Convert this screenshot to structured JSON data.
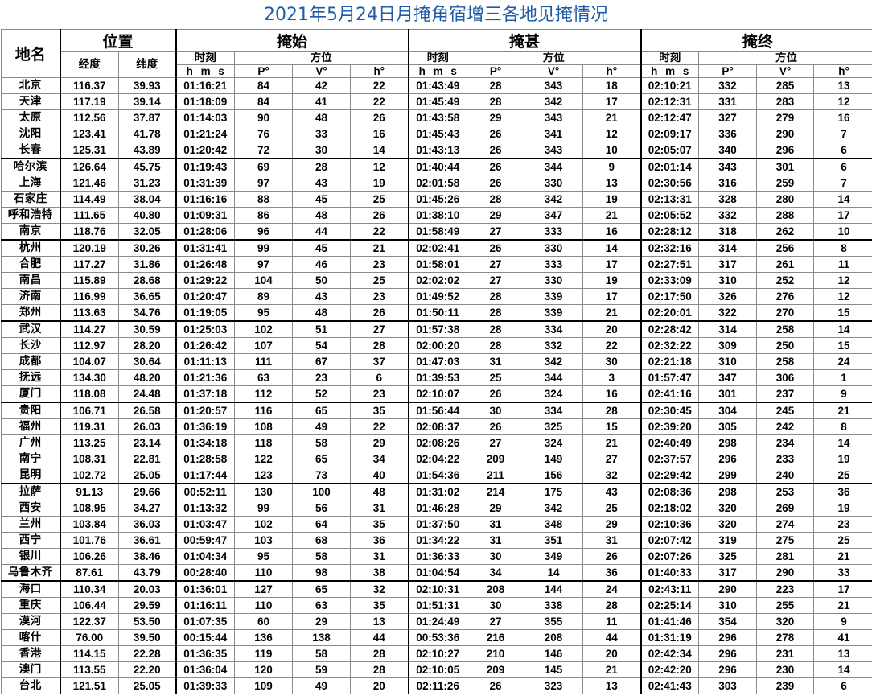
{
  "title": "2021年5月24日月掩角宿增三各地见掩情况",
  "headers": {
    "city": "地名",
    "position": "位置",
    "longitude": "经度",
    "latitude": "纬度",
    "start": "掩始",
    "mid": "掩甚",
    "end": "掩终",
    "time": "时刻",
    "hms": "h m s",
    "azimuth": "方位",
    "p": "P°",
    "v": "V°",
    "h": "h°"
  },
  "groups": [
    [
      [
        "北京",
        "116.37",
        "39.93",
        "01:16:21",
        "84",
        "42",
        "22",
        "01:43:49",
        "28",
        "343",
        "18",
        "02:10:21",
        "332",
        "285",
        "13"
      ],
      [
        "天津",
        "117.19",
        "39.14",
        "01:18:09",
        "84",
        "41",
        "22",
        "01:45:49",
        "28",
        "342",
        "17",
        "02:12:31",
        "331",
        "283",
        "12"
      ],
      [
        "太原",
        "112.56",
        "37.87",
        "01:14:03",
        "90",
        "48",
        "26",
        "01:43:58",
        "29",
        "343",
        "21",
        "02:12:47",
        "327",
        "279",
        "16"
      ],
      [
        "沈阳",
        "123.41",
        "41.78",
        "01:21:24",
        "76",
        "33",
        "16",
        "01:45:43",
        "26",
        "341",
        "12",
        "02:09:17",
        "336",
        "290",
        "7"
      ],
      [
        "长春",
        "125.31",
        "43.89",
        "01:20:42",
        "72",
        "30",
        "14",
        "01:43:13",
        "26",
        "343",
        "10",
        "02:05:07",
        "340",
        "296",
        "6"
      ]
    ],
    [
      [
        "哈尔滨",
        "126.64",
        "45.75",
        "01:19:43",
        "69",
        "28",
        "12",
        "01:40:44",
        "26",
        "344",
        "9",
        "02:01:14",
        "343",
        "301",
        "6"
      ],
      [
        "上海",
        "121.46",
        "31.23",
        "01:31:39",
        "97",
        "43",
        "19",
        "02:01:58",
        "26",
        "330",
        "13",
        "02:30:56",
        "316",
        "259",
        "7"
      ],
      [
        "石家庄",
        "114.49",
        "38.04",
        "01:16:16",
        "88",
        "45",
        "25",
        "01:45:26",
        "28",
        "342",
        "19",
        "02:13:31",
        "328",
        "280",
        "14"
      ],
      [
        "呼和浩特",
        "111.65",
        "40.80",
        "01:09:31",
        "86",
        "48",
        "26",
        "01:38:10",
        "29",
        "347",
        "21",
        "02:05:52",
        "332",
        "288",
        "17"
      ],
      [
        "南京",
        "118.76",
        "32.05",
        "01:28:06",
        "96",
        "44",
        "22",
        "01:58:49",
        "27",
        "333",
        "16",
        "02:28:12",
        "318",
        "262",
        "10"
      ]
    ],
    [
      [
        "杭州",
        "120.19",
        "30.26",
        "01:31:41",
        "99",
        "45",
        "21",
        "02:02:41",
        "26",
        "330",
        "14",
        "02:32:16",
        "314",
        "256",
        "8"
      ],
      [
        "合肥",
        "117.27",
        "31.86",
        "01:26:48",
        "97",
        "46",
        "23",
        "01:58:01",
        "27",
        "333",
        "17",
        "02:27:51",
        "317",
        "261",
        "11"
      ],
      [
        "南昌",
        "115.89",
        "28.68",
        "01:29:22",
        "104",
        "50",
        "25",
        "02:02:02",
        "27",
        "330",
        "19",
        "02:33:09",
        "310",
        "252",
        "12"
      ],
      [
        "济南",
        "116.99",
        "36.65",
        "01:20:47",
        "89",
        "43",
        "23",
        "01:49:52",
        "28",
        "339",
        "17",
        "02:17:50",
        "326",
        "276",
        "12"
      ],
      [
        "郑州",
        "113.63",
        "34.76",
        "01:19:05",
        "95",
        "48",
        "26",
        "01:50:11",
        "28",
        "339",
        "21",
        "02:20:01",
        "322",
        "270",
        "15"
      ]
    ],
    [
      [
        "武汉",
        "114.27",
        "30.59",
        "01:25:03",
        "102",
        "51",
        "27",
        "01:57:38",
        "28",
        "334",
        "20",
        "02:28:42",
        "314",
        "258",
        "14"
      ],
      [
        "长沙",
        "112.97",
        "28.20",
        "01:26:42",
        "107",
        "54",
        "28",
        "02:00:20",
        "28",
        "332",
        "22",
        "02:32:22",
        "309",
        "250",
        "15"
      ],
      [
        "成都",
        "104.07",
        "30.64",
        "01:11:13",
        "111",
        "67",
        "37",
        "01:47:03",
        "31",
        "342",
        "30",
        "02:21:18",
        "310",
        "258",
        "24"
      ],
      [
        "抚远",
        "134.30",
        "48.20",
        "01:21:36",
        "63",
        "23",
        "6",
        "01:39:53",
        "25",
        "344",
        "3",
        "01:57:47",
        "347",
        "306",
        "1"
      ],
      [
        "厦门",
        "118.08",
        "24.48",
        "01:37:18",
        "112",
        "52",
        "23",
        "02:10:07",
        "26",
        "324",
        "16",
        "02:41:16",
        "301",
        "237",
        "9"
      ]
    ],
    [
      [
        "贵阳",
        "106.71",
        "26.58",
        "01:20:57",
        "116",
        "65",
        "35",
        "01:56:44",
        "30",
        "334",
        "28",
        "02:30:45",
        "304",
        "245",
        "21"
      ],
      [
        "福州",
        "119.31",
        "26.03",
        "01:36:19",
        "108",
        "49",
        "22",
        "02:08:37",
        "26",
        "325",
        "15",
        "02:39:20",
        "305",
        "242",
        "8"
      ],
      [
        "广州",
        "113.25",
        "23.14",
        "01:34:18",
        "118",
        "58",
        "29",
        "02:08:26",
        "27",
        "324",
        "21",
        "02:40:49",
        "298",
        "234",
        "14"
      ],
      [
        "南宁",
        "108.31",
        "22.81",
        "01:28:58",
        "122",
        "65",
        "34",
        "02:04:22",
        "209",
        "149",
        "27",
        "02:37:57",
        "296",
        "233",
        "19"
      ],
      [
        "昆明",
        "102.72",
        "25.05",
        "01:17:44",
        "123",
        "73",
        "40",
        "01:54:36",
        "211",
        "156",
        "32",
        "02:29:42",
        "299",
        "240",
        "25"
      ]
    ],
    [
      [
        "拉萨",
        "91.13",
        "29.66",
        "00:52:11",
        "130",
        "100",
        "48",
        "01:31:02",
        "214",
        "175",
        "43",
        "02:08:36",
        "298",
        "253",
        "36"
      ],
      [
        "西安",
        "108.95",
        "34.27",
        "01:13:32",
        "99",
        "56",
        "31",
        "01:46:28",
        "29",
        "342",
        "25",
        "02:18:02",
        "320",
        "269",
        "19"
      ],
      [
        "兰州",
        "103.84",
        "36.03",
        "01:03:47",
        "102",
        "64",
        "35",
        "01:37:50",
        "31",
        "348",
        "29",
        "02:10:36",
        "320",
        "274",
        "23"
      ],
      [
        "西宁",
        "101.76",
        "36.61",
        "00:59:47",
        "103",
        "68",
        "36",
        "01:34:22",
        "31",
        "351",
        "31",
        "02:07:42",
        "319",
        "275",
        "25"
      ],
      [
        "银川",
        "106.26",
        "38.46",
        "01:04:34",
        "95",
        "58",
        "31",
        "01:36:33",
        "30",
        "349",
        "26",
        "02:07:26",
        "325",
        "281",
        "21"
      ],
      [
        "乌鲁木齐",
        "87.61",
        "43.79",
        "00:28:40",
        "110",
        "98",
        "38",
        "01:04:54",
        "34",
        "14",
        "36",
        "01:40:33",
        "317",
        "290",
        "33"
      ]
    ],
    [
      [
        "海口",
        "110.34",
        "20.03",
        "01:36:01",
        "127",
        "65",
        "32",
        "02:10:31",
        "208",
        "144",
        "24",
        "02:43:11",
        "290",
        "223",
        "17"
      ],
      [
        "重庆",
        "106.44",
        "29.59",
        "01:16:11",
        "110",
        "63",
        "35",
        "01:51:31",
        "30",
        "338",
        "28",
        "02:25:14",
        "310",
        "255",
        "21"
      ],
      [
        "漠河",
        "122.37",
        "53.50",
        "01:07:35",
        "60",
        "29",
        "13",
        "01:24:49",
        "27",
        "355",
        "11",
        "01:41:46",
        "354",
        "320",
        "9"
      ],
      [
        "喀什",
        "76.00",
        "39.50",
        "00:15:44",
        "136",
        "138",
        "44",
        "00:53:36",
        "216",
        "208",
        "44",
        "01:31:19",
        "296",
        "278",
        "41"
      ],
      [
        "香港",
        "114.15",
        "22.28",
        "01:36:35",
        "119",
        "58",
        "28",
        "02:10:27",
        "210",
        "146",
        "20",
        "02:42:34",
        "296",
        "231",
        "13"
      ],
      [
        "澳门",
        "113.55",
        "22.20",
        "01:36:04",
        "120",
        "59",
        "28",
        "02:10:05",
        "209",
        "145",
        "21",
        "02:42:20",
        "296",
        "230",
        "14"
      ],
      [
        "台北",
        "121.51",
        "25.05",
        "01:39:33",
        "109",
        "49",
        "20",
        "02:11:26",
        "26",
        "323",
        "13",
        "02:41:43",
        "303",
        "239",
        "6"
      ]
    ]
  ]
}
